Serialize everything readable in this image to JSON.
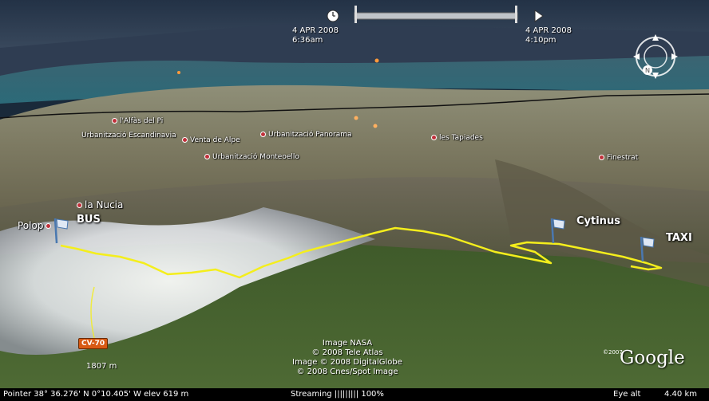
{
  "time": {
    "start_date": "4 APR 2008",
    "start_time": "6:36am",
    "end_date": "4 APR 2008",
    "end_time": "4:10pm"
  },
  "places": {
    "alfas": "l'Alfàs del Pi",
    "escandinavia": "Urbanització Escandinavia",
    "alpe": "Venta de Alpe",
    "panorama": "Urbanització Panorama",
    "monteoello": "Urbanització Monteoello",
    "tapiades": "les Tapiades",
    "finestrat": "Finestrat",
    "nucia": "la Nucia",
    "polop": "Polop"
  },
  "markers": {
    "bus": "BUS",
    "cytinus": "Cytinus",
    "taxi": "TAXI"
  },
  "road_label": "CV-70",
  "elevation_label": "1807 m",
  "credits": [
    "Image NASA",
    "© 2008 Tele Atlas",
    "Image © 2008 DigitalGlobe",
    "© 2008 Cnes/Spot Image"
  ],
  "logo": {
    "copyright": "©2007",
    "text": "Google"
  },
  "compass_letter": "N",
  "status": {
    "pointer": "Pointer   38° 36.276' N     0°10.405' W     elev  619 m",
    "streaming": "Streaming ||||||||| 100%",
    "eye": "Eye alt",
    "eye_value": "4.40 km"
  },
  "colors": {
    "track": "#f4ee1c",
    "sea": "#1f5a6a",
    "sky": "#2a3a4e"
  }
}
